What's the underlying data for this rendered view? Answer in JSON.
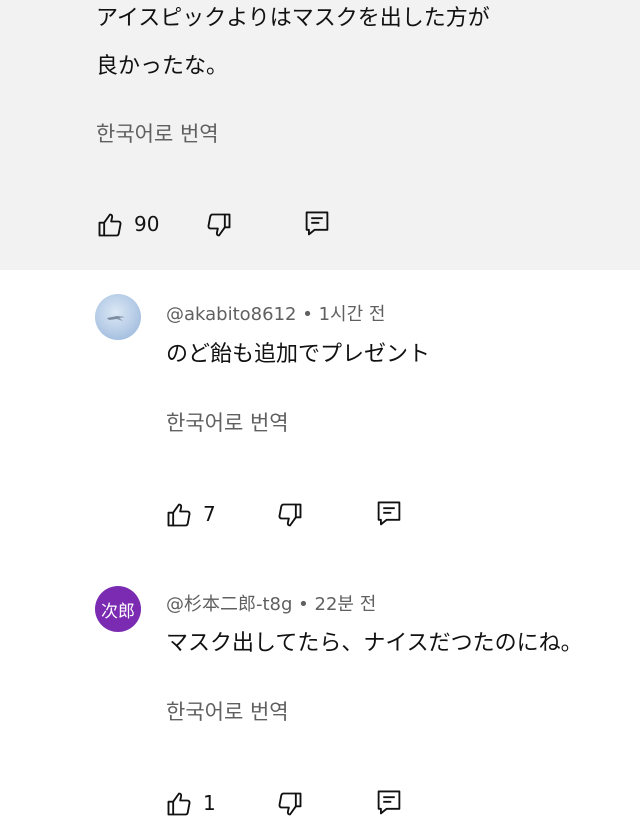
{
  "comments": [
    {
      "text_line1": "アイスピックよりはマスクを出した方が",
      "text_line2": "良かったな。",
      "translate": "한국어로 번역",
      "likes": "90"
    },
    {
      "handle": "@akabito8612",
      "separator": "•",
      "time": "1시간 전",
      "text": "のど飴も追加でプレゼント",
      "translate": "한국어로 번역",
      "likes": "7"
    },
    {
      "avatar_text": "次郎",
      "handle": "@杉本二郎-t8g",
      "separator": "•",
      "time": "22분 전",
      "text": "マスク出してたら、ナイスだつたのにね。",
      "translate": "한국어로 번역",
      "likes": "1"
    }
  ],
  "icons": {
    "like": "thumb-up-icon",
    "dislike": "thumb-down-icon",
    "reply": "reply-icon"
  }
}
